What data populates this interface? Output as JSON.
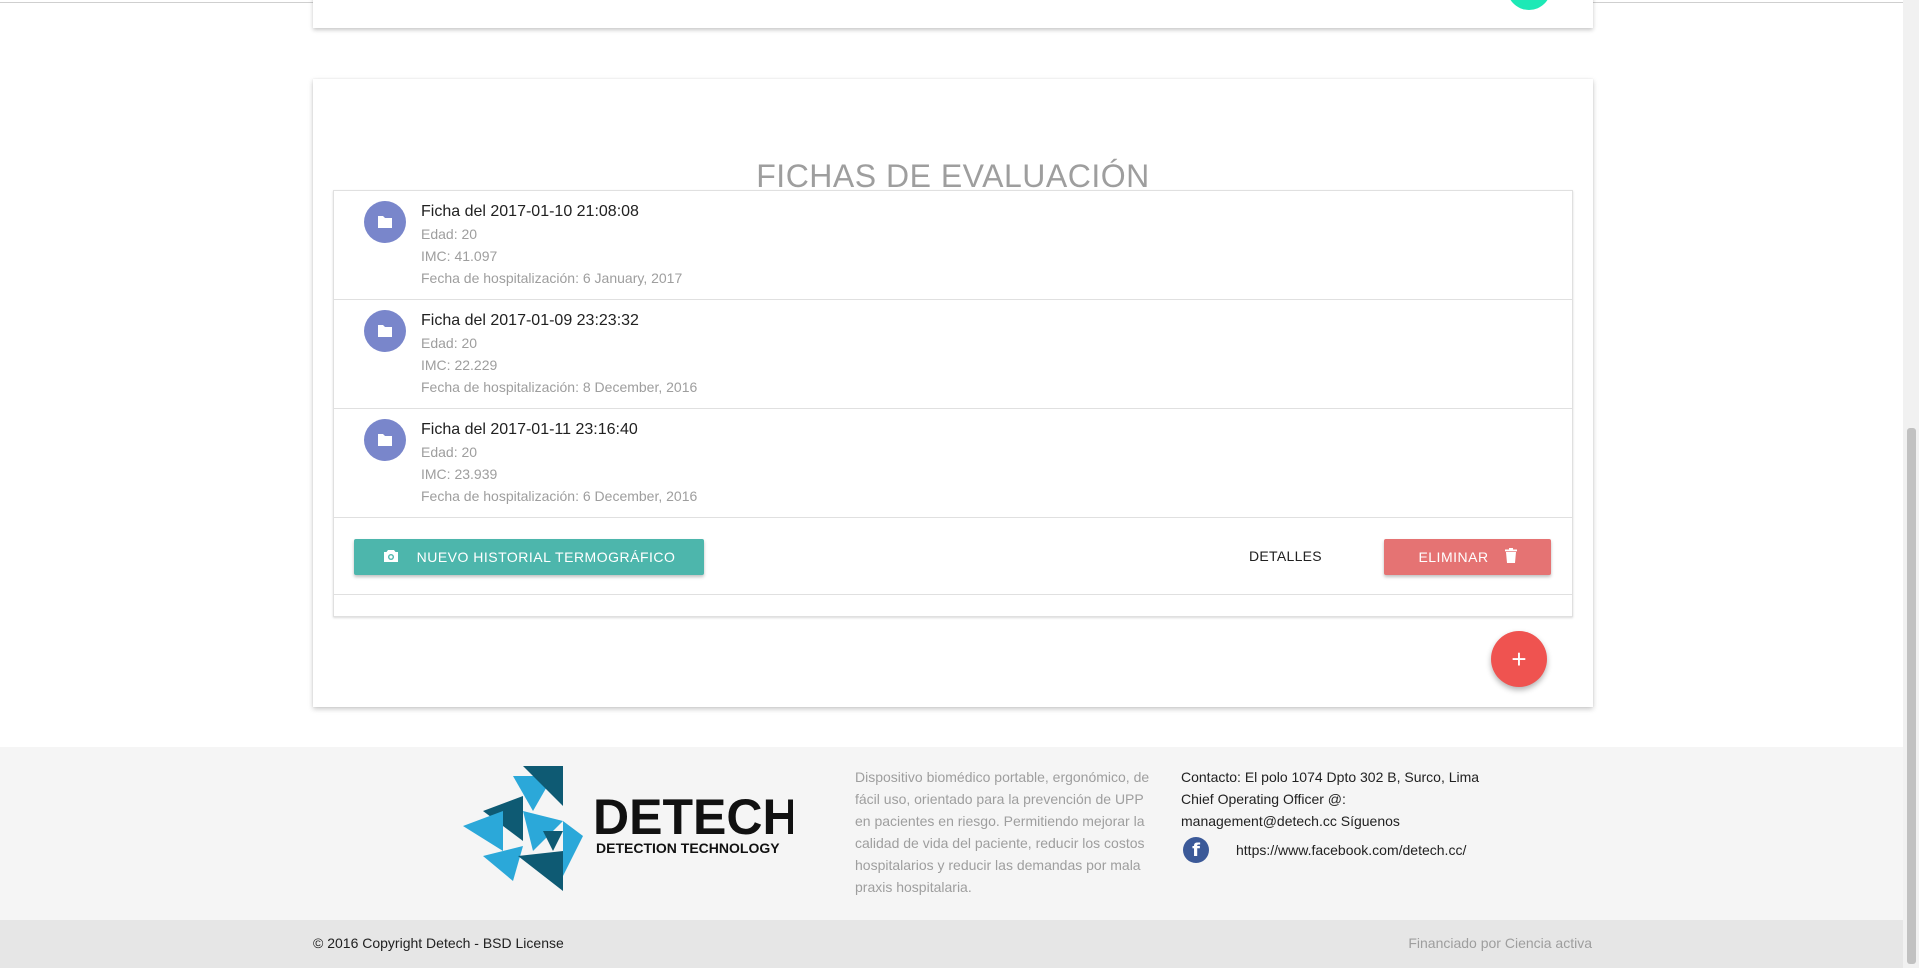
{
  "section": {
    "title": "FICHAS DE EVALUACIÓN"
  },
  "fichas": [
    {
      "title": "Ficha del 2017-01-10 21:08:08",
      "edad": "Edad: 20",
      "imc": "IMC: 41.097",
      "fecha": "Fecha de hospitalización: 6 January, 2017"
    },
    {
      "title": "Ficha del 2017-01-09 23:23:32",
      "edad": "Edad: 20",
      "imc": "IMC: 22.229",
      "fecha": "Fecha de hospitalización: 8 December, 2016"
    },
    {
      "title": "Ficha del 2017-01-11 23:16:40",
      "edad": "Edad: 20",
      "imc": "IMC: 23.939",
      "fecha": "Fecha de hospitalización: 6 December, 2016"
    }
  ],
  "actions": {
    "nuevo": "NUEVO HISTORIAL TERMOGRÁFICO",
    "detalles": "DETALLES",
    "eliminar": "ELIMINAR",
    "add": "+"
  },
  "footer": {
    "logo_name": "DETECH",
    "logo_tagline": "DETECTION TECHNOLOGY",
    "description": "Dispositivo biomédico portable, ergonómico, de fácil uso, orientado para la prevención de UPP en pacientes en riesgo. Permitiendo mejorar la calidad de vida del paciente, reducir los costos hospitalarios y reducir las demandas por mala praxis hospitalaria.",
    "contact": "Contacto: El polo 1074 Dpto 302 B, Surco, Lima Chief Operating Officer @: management@detech.cc Síguenos",
    "facebook_icon": "f",
    "facebook_url": "https://www.facebook.com/detech.cc/",
    "copyright": "© 2016 Copyright Detech - BSD License",
    "funded": "Financiado por Ciencia activa"
  },
  "colors": {
    "avatar": "#7986cb",
    "teal": "#4db6ac",
    "red": "#e57373",
    "fab": "#ef5350"
  }
}
